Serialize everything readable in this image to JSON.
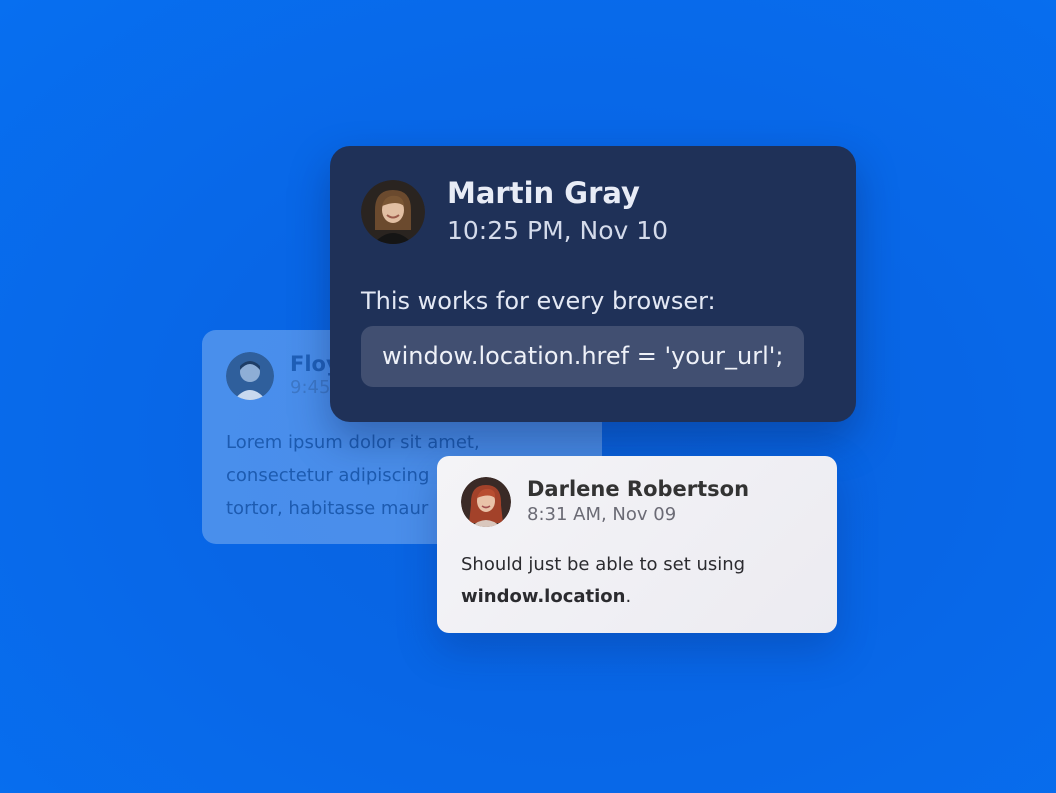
{
  "background_color": "#0a66e4",
  "cards": {
    "back": {
      "author": "Floy",
      "time": "9:45",
      "message_lines": [
        "Lorem ipsum dolor sit amet,",
        "consectetur adipiscing",
        "tortor, habitasse maur"
      ],
      "avatar_icon": "man-avatar-icon"
    },
    "main": {
      "author": "Martin Gray",
      "time": "10:25 PM, Nov 10",
      "message": "This works for every browser:",
      "code": "window.location.href = 'your_url';",
      "avatar_icon": "woman-avatar-icon",
      "colors": {
        "card": "#1f3158",
        "code_bg": "#414f71"
      }
    },
    "light": {
      "author": "Darlene Robertson",
      "time": "8:31 AM, Nov 09",
      "message_line1": "Should just be able to set using",
      "message_bold": "window.location",
      "message_end": ".",
      "avatar_icon": "red-haired-woman-avatar-icon"
    }
  }
}
